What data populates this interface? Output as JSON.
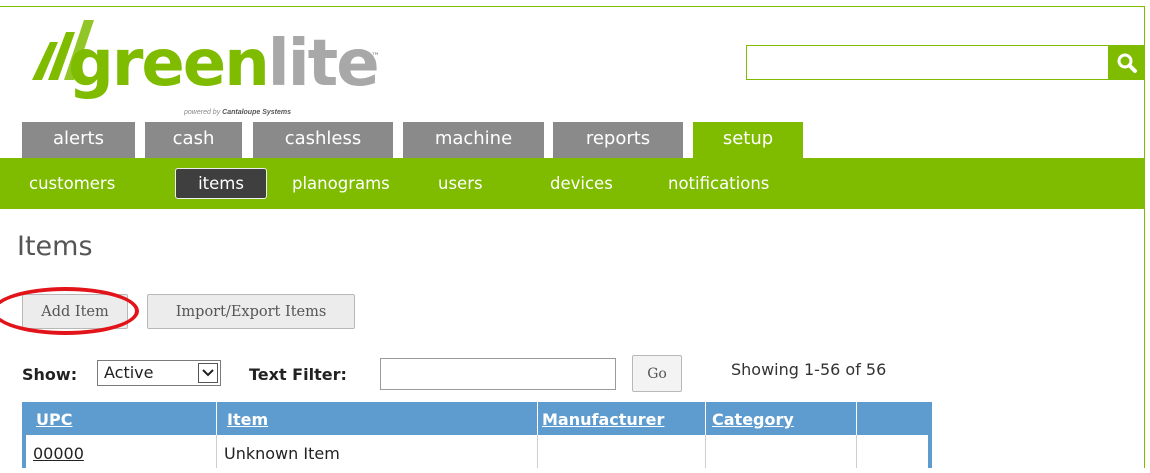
{
  "logo": {
    "word_green": "green",
    "word_gray": "lite",
    "tm": "™",
    "powered_prefix": "powered by ",
    "powered_brand": "Cantaloupe Systems"
  },
  "search": {
    "value": "",
    "placeholder": "",
    "icon": "search-icon"
  },
  "main_tabs": [
    {
      "label": "alerts",
      "active": false
    },
    {
      "label": "cash",
      "active": false
    },
    {
      "label": "cashless",
      "active": false
    },
    {
      "label": "machine",
      "active": false
    },
    {
      "label": "reports",
      "active": false
    },
    {
      "label": "setup",
      "active": true
    }
  ],
  "sub_nav": [
    {
      "label": "customers",
      "active": false
    },
    {
      "label": "items",
      "active": true
    },
    {
      "label": "planograms",
      "active": false
    },
    {
      "label": "users",
      "active": false
    },
    {
      "label": "devices",
      "active": false
    },
    {
      "label": "notifications",
      "active": false
    }
  ],
  "page": {
    "title": "Items",
    "add_item_label": "Add Item",
    "import_export_label": "Import/Export Items"
  },
  "filters": {
    "show_label": "Show:",
    "show_value": "Active",
    "text_filter_label": "Text Filter:",
    "text_filter_value": "",
    "go_label": "Go",
    "showing_text": "Showing 1-56 of 56"
  },
  "table": {
    "columns": [
      "UPC",
      "Item",
      "Manufacturer",
      "Category",
      ""
    ],
    "rows": [
      {
        "upc": "00000",
        "item": "Unknown Item",
        "manufacturer": "",
        "category": "",
        "extra": ""
      }
    ]
  },
  "colors": {
    "brand_green": "#7fbc00",
    "tab_gray": "#8a8a8a",
    "table_header_blue": "#5e9cd0",
    "annotation_red": "#e2141a"
  }
}
